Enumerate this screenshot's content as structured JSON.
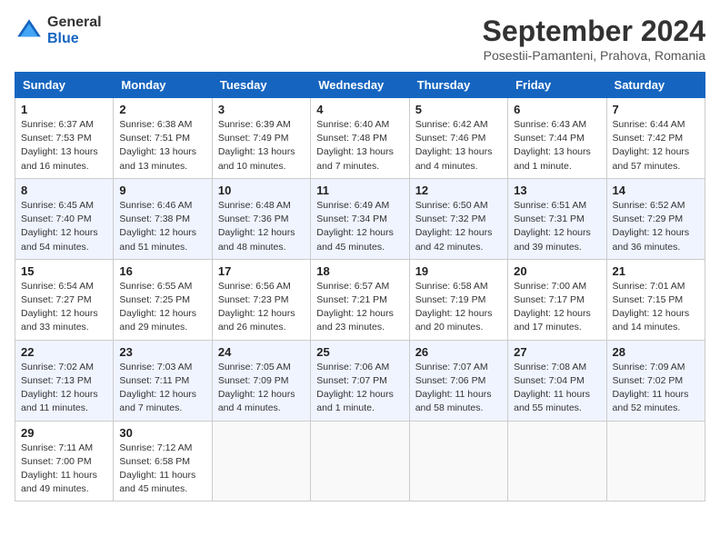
{
  "logo": {
    "general": "General",
    "blue": "Blue"
  },
  "title": "September 2024",
  "subtitle": "Posestii-Pamanteni, Prahova, Romania",
  "weekdays": [
    "Sunday",
    "Monday",
    "Tuesday",
    "Wednesday",
    "Thursday",
    "Friday",
    "Saturday"
  ],
  "weeks": [
    [
      {
        "day": "1",
        "info": "Sunrise: 6:37 AM\nSunset: 7:53 PM\nDaylight: 13 hours\nand 16 minutes."
      },
      {
        "day": "2",
        "info": "Sunrise: 6:38 AM\nSunset: 7:51 PM\nDaylight: 13 hours\nand 13 minutes."
      },
      {
        "day": "3",
        "info": "Sunrise: 6:39 AM\nSunset: 7:49 PM\nDaylight: 13 hours\nand 10 minutes."
      },
      {
        "day": "4",
        "info": "Sunrise: 6:40 AM\nSunset: 7:48 PM\nDaylight: 13 hours\nand 7 minutes."
      },
      {
        "day": "5",
        "info": "Sunrise: 6:42 AM\nSunset: 7:46 PM\nDaylight: 13 hours\nand 4 minutes."
      },
      {
        "day": "6",
        "info": "Sunrise: 6:43 AM\nSunset: 7:44 PM\nDaylight: 13 hours\nand 1 minute."
      },
      {
        "day": "7",
        "info": "Sunrise: 6:44 AM\nSunset: 7:42 PM\nDaylight: 12 hours\nand 57 minutes."
      }
    ],
    [
      {
        "day": "8",
        "info": "Sunrise: 6:45 AM\nSunset: 7:40 PM\nDaylight: 12 hours\nand 54 minutes."
      },
      {
        "day": "9",
        "info": "Sunrise: 6:46 AM\nSunset: 7:38 PM\nDaylight: 12 hours\nand 51 minutes."
      },
      {
        "day": "10",
        "info": "Sunrise: 6:48 AM\nSunset: 7:36 PM\nDaylight: 12 hours\nand 48 minutes."
      },
      {
        "day": "11",
        "info": "Sunrise: 6:49 AM\nSunset: 7:34 PM\nDaylight: 12 hours\nand 45 minutes."
      },
      {
        "day": "12",
        "info": "Sunrise: 6:50 AM\nSunset: 7:32 PM\nDaylight: 12 hours\nand 42 minutes."
      },
      {
        "day": "13",
        "info": "Sunrise: 6:51 AM\nSunset: 7:31 PM\nDaylight: 12 hours\nand 39 minutes."
      },
      {
        "day": "14",
        "info": "Sunrise: 6:52 AM\nSunset: 7:29 PM\nDaylight: 12 hours\nand 36 minutes."
      }
    ],
    [
      {
        "day": "15",
        "info": "Sunrise: 6:54 AM\nSunset: 7:27 PM\nDaylight: 12 hours\nand 33 minutes."
      },
      {
        "day": "16",
        "info": "Sunrise: 6:55 AM\nSunset: 7:25 PM\nDaylight: 12 hours\nand 29 minutes."
      },
      {
        "day": "17",
        "info": "Sunrise: 6:56 AM\nSunset: 7:23 PM\nDaylight: 12 hours\nand 26 minutes."
      },
      {
        "day": "18",
        "info": "Sunrise: 6:57 AM\nSunset: 7:21 PM\nDaylight: 12 hours\nand 23 minutes."
      },
      {
        "day": "19",
        "info": "Sunrise: 6:58 AM\nSunset: 7:19 PM\nDaylight: 12 hours\nand 20 minutes."
      },
      {
        "day": "20",
        "info": "Sunrise: 7:00 AM\nSunset: 7:17 PM\nDaylight: 12 hours\nand 17 minutes."
      },
      {
        "day": "21",
        "info": "Sunrise: 7:01 AM\nSunset: 7:15 PM\nDaylight: 12 hours\nand 14 minutes."
      }
    ],
    [
      {
        "day": "22",
        "info": "Sunrise: 7:02 AM\nSunset: 7:13 PM\nDaylight: 12 hours\nand 11 minutes."
      },
      {
        "day": "23",
        "info": "Sunrise: 7:03 AM\nSunset: 7:11 PM\nDaylight: 12 hours\nand 7 minutes."
      },
      {
        "day": "24",
        "info": "Sunrise: 7:05 AM\nSunset: 7:09 PM\nDaylight: 12 hours\nand 4 minutes."
      },
      {
        "day": "25",
        "info": "Sunrise: 7:06 AM\nSunset: 7:07 PM\nDaylight: 12 hours\nand 1 minute."
      },
      {
        "day": "26",
        "info": "Sunrise: 7:07 AM\nSunset: 7:06 PM\nDaylight: 11 hours\nand 58 minutes."
      },
      {
        "day": "27",
        "info": "Sunrise: 7:08 AM\nSunset: 7:04 PM\nDaylight: 11 hours\nand 55 minutes."
      },
      {
        "day": "28",
        "info": "Sunrise: 7:09 AM\nSunset: 7:02 PM\nDaylight: 11 hours\nand 52 minutes."
      }
    ],
    [
      {
        "day": "29",
        "info": "Sunrise: 7:11 AM\nSunset: 7:00 PM\nDaylight: 11 hours\nand 49 minutes."
      },
      {
        "day": "30",
        "info": "Sunrise: 7:12 AM\nSunset: 6:58 PM\nDaylight: 11 hours\nand 45 minutes."
      },
      {
        "day": "",
        "info": ""
      },
      {
        "day": "",
        "info": ""
      },
      {
        "day": "",
        "info": ""
      },
      {
        "day": "",
        "info": ""
      },
      {
        "day": "",
        "info": ""
      }
    ]
  ]
}
